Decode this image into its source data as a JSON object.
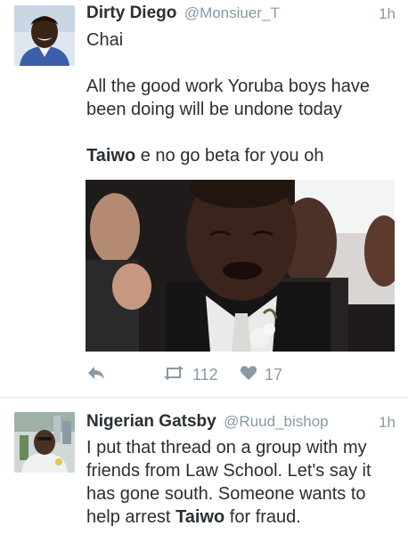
{
  "tweets": [
    {
      "author_name": "Dirty Diego",
      "handle": "@Monsiuer_T",
      "time": "1h",
      "lines": [
        "Chai",
        "",
        "All the good work Yoruba boys have",
        "been doing will be undone today",
        ""
      ],
      "bold_word": "Taiwo",
      "last_line_rest": " e no go beta for you oh",
      "retweet_count": "112",
      "like_count": "17"
    },
    {
      "author_name": "Nigerian Gatsby",
      "handle": "@Ruud_bishop",
      "time": "1h",
      "lines": [
        "I put that thread on a group with my",
        "friends from Law School. Let's say it",
        "has gone south. Someone wants to"
      ],
      "last_line_prefix": "help arrest ",
      "bold_word": "Taiwo",
      "last_line_rest": " for fraud."
    }
  ],
  "icons": {
    "reply": "reply-icon",
    "retweet": "retweet-icon",
    "like": "heart-icon"
  },
  "colors": {
    "text": "#292f33",
    "muted": "#8899a6",
    "divider": "#e1e8ed"
  }
}
